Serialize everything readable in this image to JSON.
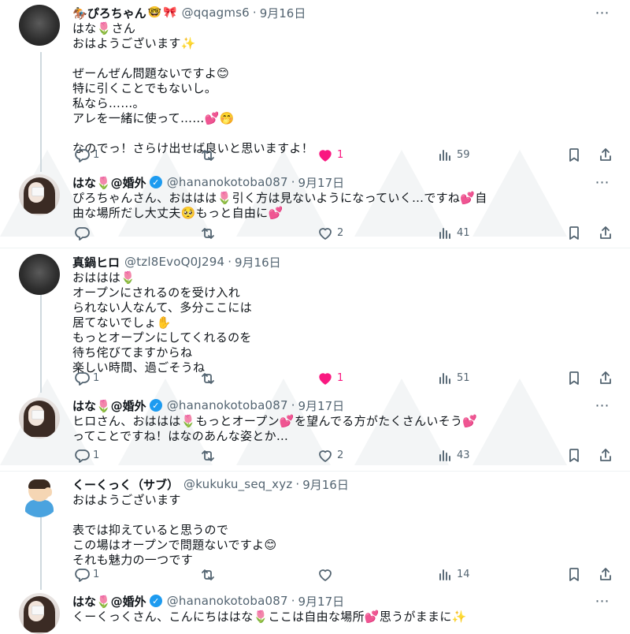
{
  "tweets": [
    {
      "name": "ぴろちゃん",
      "name_emojis": [
        "🤓",
        "🎀"
      ],
      "handle": "@qqagms6",
      "date": "9月16日",
      "verified": false,
      "lines": [
        "はな🌷さん",
        "おはようございます✨",
        "",
        "ぜーんぜん問題ないですよ😊",
        "特に引くことでもないし。",
        "私なら……。",
        "アレを一緒に使って……💕🤭",
        "",
        "なのでっ！さらけ出せば良いと思いますよ！"
      ],
      "reply_count": "1",
      "retweet_count": "",
      "like_count": "1",
      "liked": true,
      "views": "59"
    },
    {
      "name": "はな🌷@婚外",
      "name_emojis": [],
      "handle": "@hananokotoba087",
      "date": "9月17日",
      "verified": true,
      "lines": [
        "ぴろちゃんさん、おははは🌷引く方は見ないようになっていく…ですね💕自",
        "由な場所だし大丈夫🥺もっと自由に💕"
      ],
      "reply_count": "",
      "retweet_count": "",
      "like_count": "2",
      "liked": false,
      "views": "41"
    },
    {
      "name": "真鍋ヒロ",
      "name_emojis": [],
      "handle": "@tzl8EvoQ0J294",
      "date": "9月16日",
      "verified": false,
      "lines": [
        "おははは🌷",
        "オープンにされるのを受け入れ",
        "られない人なんて、多分ここには",
        "居てないでしょ✋",
        "もっとオープンにしてくれるのを",
        "待ち侘びてますからね",
        "楽しい時間、過ごそうね"
      ],
      "reply_count": "1",
      "retweet_count": "",
      "like_count": "1",
      "liked": true,
      "views": "51"
    },
    {
      "name": "はな🌷@婚外",
      "name_emojis": [],
      "handle": "@hananokotoba087",
      "date": "9月17日",
      "verified": true,
      "lines": [
        "ヒロさん、おははは🌷もっとオープン💕を望んでる方がたくさんいそう💕",
        "ってことですね！はなのあんな姿とか…"
      ],
      "reply_count": "1",
      "retweet_count": "",
      "like_count": "2",
      "liked": false,
      "views": "43"
    },
    {
      "name": "くーくっく（サブ）",
      "name_emojis": [],
      "handle": "@kukuku_seq_xyz",
      "date": "9月16日",
      "verified": false,
      "lines": [
        "おはようございます",
        "",
        "表では抑えていると思うので",
        "この場はオープンで問題ないですよ😊",
        "それも魅力の一つです"
      ],
      "reply_count": "1",
      "retweet_count": "",
      "like_count": "",
      "liked": false,
      "views": "14"
    },
    {
      "name": "はな🌷@婚外",
      "name_emojis": [],
      "handle": "@hananokotoba087",
      "date": "9月17日",
      "verified": true,
      "lines": [
        "くーくっくさん、こんにちははな🌷ここは自由な場所💕思うがままに✨"
      ],
      "reply_count": "",
      "retweet_count": "",
      "like_count": "",
      "liked": false,
      "views": ""
    }
  ],
  "icons": {
    "reply": "reply-icon",
    "retweet": "retweet-icon",
    "like": "heart-icon",
    "views": "views-icon",
    "bookmark": "bookmark-icon",
    "share": "share-icon",
    "more": "more-icon",
    "verified": "verified-badge-icon"
  },
  "colors": {
    "like_active": "#f91880",
    "verified": "#1d9bf0",
    "muted": "#536471"
  }
}
